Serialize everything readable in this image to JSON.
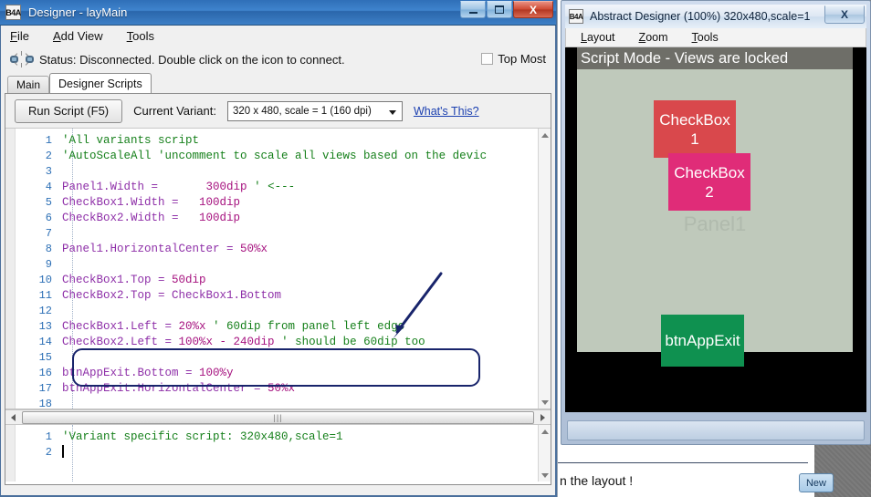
{
  "left_window": {
    "title": "Designer - layMain",
    "logo": "B4A",
    "window_buttons": {
      "minimize": "minimize-button",
      "maximize": "maximize-button",
      "close": "X"
    },
    "menu": [
      {
        "label": "File",
        "accel": "F"
      },
      {
        "label": "Add View",
        "accel": "A"
      },
      {
        "label": "Tools",
        "accel": "T"
      }
    ],
    "status": {
      "icon": "disconnected-link-icon",
      "text": "Status: Disconnected. Double click on the icon to connect."
    },
    "top_most": {
      "label": "Top Most",
      "checked": false
    },
    "tabs": [
      {
        "label": "Main",
        "active": false
      },
      {
        "label": "Designer Scripts",
        "active": true
      }
    ],
    "toolbar": {
      "run_script_label": "Run Script  (F5)",
      "current_variant_label": "Current Variant:",
      "variant_value": "320 x 480, scale = 1 (160 dpi)",
      "whats_this_label": "What's This?"
    },
    "main_editor": {
      "lines": [
        {
          "n": "1",
          "segments": [
            {
              "t": "'All variants script",
              "c": "cm"
            }
          ]
        },
        {
          "n": "2",
          "segments": [
            {
              "t": "'AutoScaleAll 'uncomment to scale all views based on the devic",
              "c": "cm"
            }
          ]
        },
        {
          "n": "3",
          "segments": []
        },
        {
          "n": "4",
          "segments": [
            {
              "t": "Panel1.Width = ",
              "c": "id"
            },
            {
              "t": "      300dip ",
              "c": "num"
            },
            {
              "t": "' <---",
              "c": "cm"
            }
          ]
        },
        {
          "n": "5",
          "segments": [
            {
              "t": "CheckBox1.Width = ",
              "c": "id"
            },
            {
              "t": "  100dip",
              "c": "num"
            }
          ]
        },
        {
          "n": "6",
          "segments": [
            {
              "t": "CheckBox2.Width = ",
              "c": "id"
            },
            {
              "t": "  100dip",
              "c": "num"
            }
          ]
        },
        {
          "n": "7",
          "segments": []
        },
        {
          "n": "8",
          "segments": [
            {
              "t": "Panel1.HorizontalCenter = ",
              "c": "id"
            },
            {
              "t": "50%x",
              "c": "num"
            }
          ]
        },
        {
          "n": "9",
          "segments": []
        },
        {
          "n": "10",
          "segments": [
            {
              "t": "CheckBox1.Top = ",
              "c": "id"
            },
            {
              "t": "50dip",
              "c": "num"
            }
          ]
        },
        {
          "n": "11",
          "segments": [
            {
              "t": "CheckBox2.Top = CheckBox1.Bottom",
              "c": "id"
            }
          ]
        },
        {
          "n": "12",
          "segments": []
        },
        {
          "n": "13",
          "segments": [
            {
              "t": "CheckBox1.Left = ",
              "c": "id"
            },
            {
              "t": "20%x ",
              "c": "num"
            },
            {
              "t": "' 60dip from panel left edge",
              "c": "cm"
            }
          ]
        },
        {
          "n": "14",
          "segments": [
            {
              "t": "CheckBox2.Left = ",
              "c": "id"
            },
            {
              "t": "100%x - 240dip ",
              "c": "num"
            },
            {
              "t": "' should be 60dip too",
              "c": "cm"
            }
          ]
        },
        {
          "n": "15",
          "segments": []
        },
        {
          "n": "16",
          "segments": [
            {
              "t": "btnAppExit.Bottom = ",
              "c": "id"
            },
            {
              "t": "100%y",
              "c": "num"
            }
          ]
        },
        {
          "n": "17",
          "segments": [
            {
              "t": "btnAppExit.HorizontalCenter = ",
              "c": "id"
            },
            {
              "t": "50%x",
              "c": "num"
            }
          ]
        },
        {
          "n": "18",
          "segments": []
        }
      ]
    },
    "variant_editor": {
      "lines": [
        {
          "n": "1",
          "segments": [
            {
              "t": "'Variant specific script: 320x480,scale=1",
              "c": "cm"
            }
          ]
        },
        {
          "n": "2",
          "segments": []
        }
      ]
    },
    "annotations": {
      "highlight_box": "rounded-box-around-lines-13-14",
      "arrow": "arrow-pointing-to-highlight-box",
      "color": "#18246b"
    }
  },
  "right_window": {
    "logo": "B4A",
    "title": "Abstract Designer (100%) 320x480,scale=1",
    "close_label": "X",
    "menu": [
      {
        "label": "Layout",
        "accel": "L"
      },
      {
        "label": "Zoom",
        "accel": "Z"
      },
      {
        "label": "Tools",
        "accel": "T"
      }
    ],
    "banner": "Script Mode - Views are locked",
    "canvas": {
      "panel_label": "Panel1",
      "views": [
        {
          "name": "CheckBox1",
          "label": "CheckBox1",
          "color": "#d9484c"
        },
        {
          "name": "CheckBox2",
          "label": "CheckBox2",
          "color": "#e02c78"
        },
        {
          "name": "btnAppExit",
          "label": "btnAppExit",
          "color": "#0f9150"
        }
      ]
    }
  },
  "background_window": {
    "text": "n the layout !",
    "new_button_label": "New"
  }
}
